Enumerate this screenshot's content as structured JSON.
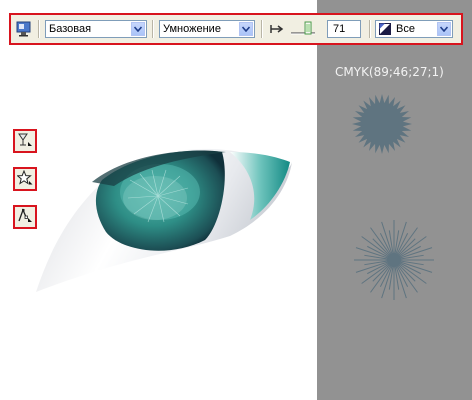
{
  "toolbar": {
    "mode": "Базовая",
    "merge": "Умножение",
    "opacity_value": "71",
    "opacity_fraction": 0.71,
    "target": "Все",
    "icons": [
      "transparency-properties-icon",
      "arrow-right-icon",
      "slider-icon",
      "target-icon"
    ]
  },
  "side_tools": [
    "interactive-transparency-icon",
    "star-shape-icon",
    "shape-edit-icon"
  ],
  "canvas": {
    "cmyk_label": "CMYK(89;46;27;1)"
  },
  "colors": {
    "accent_border": "#d8141e",
    "panel_gray": "#929292",
    "iris_teal": "#2f8f86",
    "starburst": "#5f7480"
  }
}
